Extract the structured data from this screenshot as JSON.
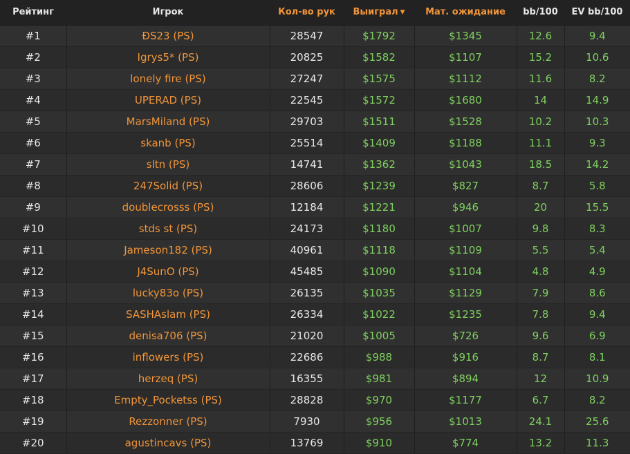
{
  "header": {
    "rank": "Рейтинг",
    "player": "Игрок",
    "hands": "Кол-во рук",
    "won": "Выиграл",
    "ev": "Мат. ожидание",
    "bb100": "bb/100",
    "evbb100": "EV bb/100"
  },
  "rows": [
    {
      "rank": "#1",
      "player": "ĐS23 (PS)",
      "hands": "28547",
      "won": "$1792",
      "ev": "$1345",
      "bb100": "12.6",
      "evbb100": "9.4"
    },
    {
      "rank": "#2",
      "player": "Igrys5* (PS)",
      "hands": "20825",
      "won": "$1582",
      "ev": "$1107",
      "bb100": "15.2",
      "evbb100": "10.6"
    },
    {
      "rank": "#3",
      "player": "lonely fire (PS)",
      "hands": "27247",
      "won": "$1575",
      "ev": "$1112",
      "bb100": "11.6",
      "evbb100": "8.2"
    },
    {
      "rank": "#4",
      "player": "UPERAD (PS)",
      "hands": "22545",
      "won": "$1572",
      "ev": "$1680",
      "bb100": "14",
      "evbb100": "14.9"
    },
    {
      "rank": "#5",
      "player": "MarsMiland (PS)",
      "hands": "29703",
      "won": "$1511",
      "ev": "$1528",
      "bb100": "10.2",
      "evbb100": "10.3"
    },
    {
      "rank": "#6",
      "player": "skanb (PS)",
      "hands": "25514",
      "won": "$1409",
      "ev": "$1188",
      "bb100": "11.1",
      "evbb100": "9.3"
    },
    {
      "rank": "#7",
      "player": "sltn (PS)",
      "hands": "14741",
      "won": "$1362",
      "ev": "$1043",
      "bb100": "18.5",
      "evbb100": "14.2"
    },
    {
      "rank": "#8",
      "player": "247Solid (PS)",
      "hands": "28606",
      "won": "$1239",
      "ev": "$827",
      "bb100": "8.7",
      "evbb100": "5.8"
    },
    {
      "rank": "#9",
      "player": "doublecrosss (PS)",
      "hands": "12184",
      "won": "$1221",
      "ev": "$946",
      "bb100": "20",
      "evbb100": "15.5"
    },
    {
      "rank": "#10",
      "player": "stds st (PS)",
      "hands": "24173",
      "won": "$1180",
      "ev": "$1007",
      "bb100": "9.8",
      "evbb100": "8.3"
    },
    {
      "rank": "#11",
      "player": "Jameson182 (PS)",
      "hands": "40961",
      "won": "$1118",
      "ev": "$1109",
      "bb100": "5.5",
      "evbb100": "5.4"
    },
    {
      "rank": "#12",
      "player": "J4SunO (PS)",
      "hands": "45485",
      "won": "$1090",
      "ev": "$1104",
      "bb100": "4.8",
      "evbb100": "4.9"
    },
    {
      "rank": "#13",
      "player": "lucky83o (PS)",
      "hands": "26135",
      "won": "$1035",
      "ev": "$1129",
      "bb100": "7.9",
      "evbb100": "8.6"
    },
    {
      "rank": "#14",
      "player": "SASHAslam (PS)",
      "hands": "26334",
      "won": "$1022",
      "ev": "$1235",
      "bb100": "7.8",
      "evbb100": "9.4"
    },
    {
      "rank": "#15",
      "player": "denisa706 (PS)",
      "hands": "21020",
      "won": "$1005",
      "ev": "$726",
      "bb100": "9.6",
      "evbb100": "6.9"
    },
    {
      "rank": "#16",
      "player": "inflowers (PS)",
      "hands": "22686",
      "won": "$988",
      "ev": "$916",
      "bb100": "8.7",
      "evbb100": "8.1"
    },
    {
      "rank": "#17",
      "player": "herzeq (PS)",
      "hands": "16355",
      "won": "$981",
      "ev": "$894",
      "bb100": "12",
      "evbb100": "10.9"
    },
    {
      "rank": "#18",
      "player": "Empty_Pocketss (PS)",
      "hands": "28828",
      "won": "$970",
      "ev": "$1177",
      "bb100": "6.7",
      "evbb100": "8.2"
    },
    {
      "rank": "#19",
      "player": "Rezzonner (PS)",
      "hands": "7930",
      "won": "$956",
      "ev": "$1013",
      "bb100": "24.1",
      "evbb100": "25.6"
    },
    {
      "rank": "#20",
      "player": "agustincavs (PS)",
      "hands": "13769",
      "won": "$910",
      "ev": "$774",
      "bb100": "13.2",
      "evbb100": "11.3"
    }
  ],
  "icons": {
    "sort": "caret-down-icon"
  },
  "colors": {
    "accent": "#f0953a",
    "positive": "#7fd15f",
    "text": "#e8e8e8"
  }
}
